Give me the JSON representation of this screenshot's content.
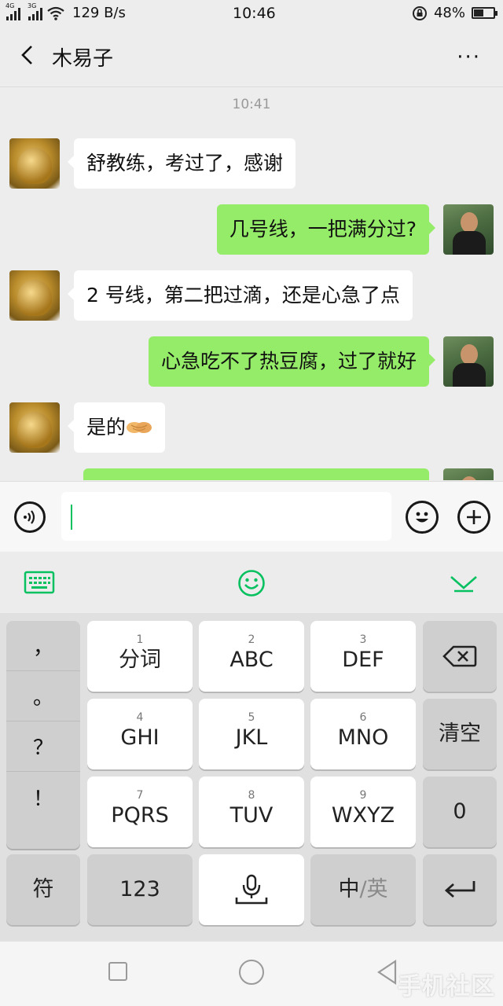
{
  "status_bar": {
    "signal1_label": "4G",
    "signal2_label": "3G",
    "speed": "129 B/s",
    "time": "10:46",
    "battery": "48%",
    "battery_level": 0.48
  },
  "header": {
    "back_icon": "chevron-left-icon",
    "title": "木易子",
    "more_label": "···"
  },
  "chat": {
    "timestamp": "10:41",
    "messages": [
      {
        "side": "in",
        "text": "舒教练，考过了，感谢"
      },
      {
        "side": "out",
        "text": "几号线，一把满分过?"
      },
      {
        "side": "in",
        "text": "2 号线，第二把过滴，还是心急了点"
      },
      {
        "side": "out",
        "text": "心急吃不了热豆腐，过了就好"
      },
      {
        "side": "in",
        "text": "是的",
        "emoji": "handshake-icon"
      }
    ]
  },
  "input_bar": {
    "voice_icon": "voice-icon",
    "emoji_icon": "emoji-face-icon",
    "plus_icon": "plus-icon",
    "text": ""
  },
  "keyboard": {
    "punctuation": [
      "，",
      "。",
      "？",
      "！"
    ],
    "keys": [
      {
        "num": "1",
        "label": "分词"
      },
      {
        "num": "2",
        "label": "ABC"
      },
      {
        "num": "3",
        "label": "DEF"
      },
      {
        "num": "4",
        "label": "GHI"
      },
      {
        "num": "5",
        "label": "JKL"
      },
      {
        "num": "6",
        "label": "MNO"
      },
      {
        "num": "7",
        "label": "PQRS"
      },
      {
        "num": "8",
        "label": "TUV"
      },
      {
        "num": "9",
        "label": "WXYZ"
      }
    ],
    "clear_label": "清空",
    "zero_label": "0",
    "symbol_label": "符",
    "num_label": "123",
    "lang_zh": "中",
    "lang_sep": "/",
    "lang_en": "英"
  },
  "colors": {
    "accent": "#07c160",
    "bubble_out": "#95ec69",
    "bubble_in": "#ffffff"
  },
  "watermark": "手机社区"
}
